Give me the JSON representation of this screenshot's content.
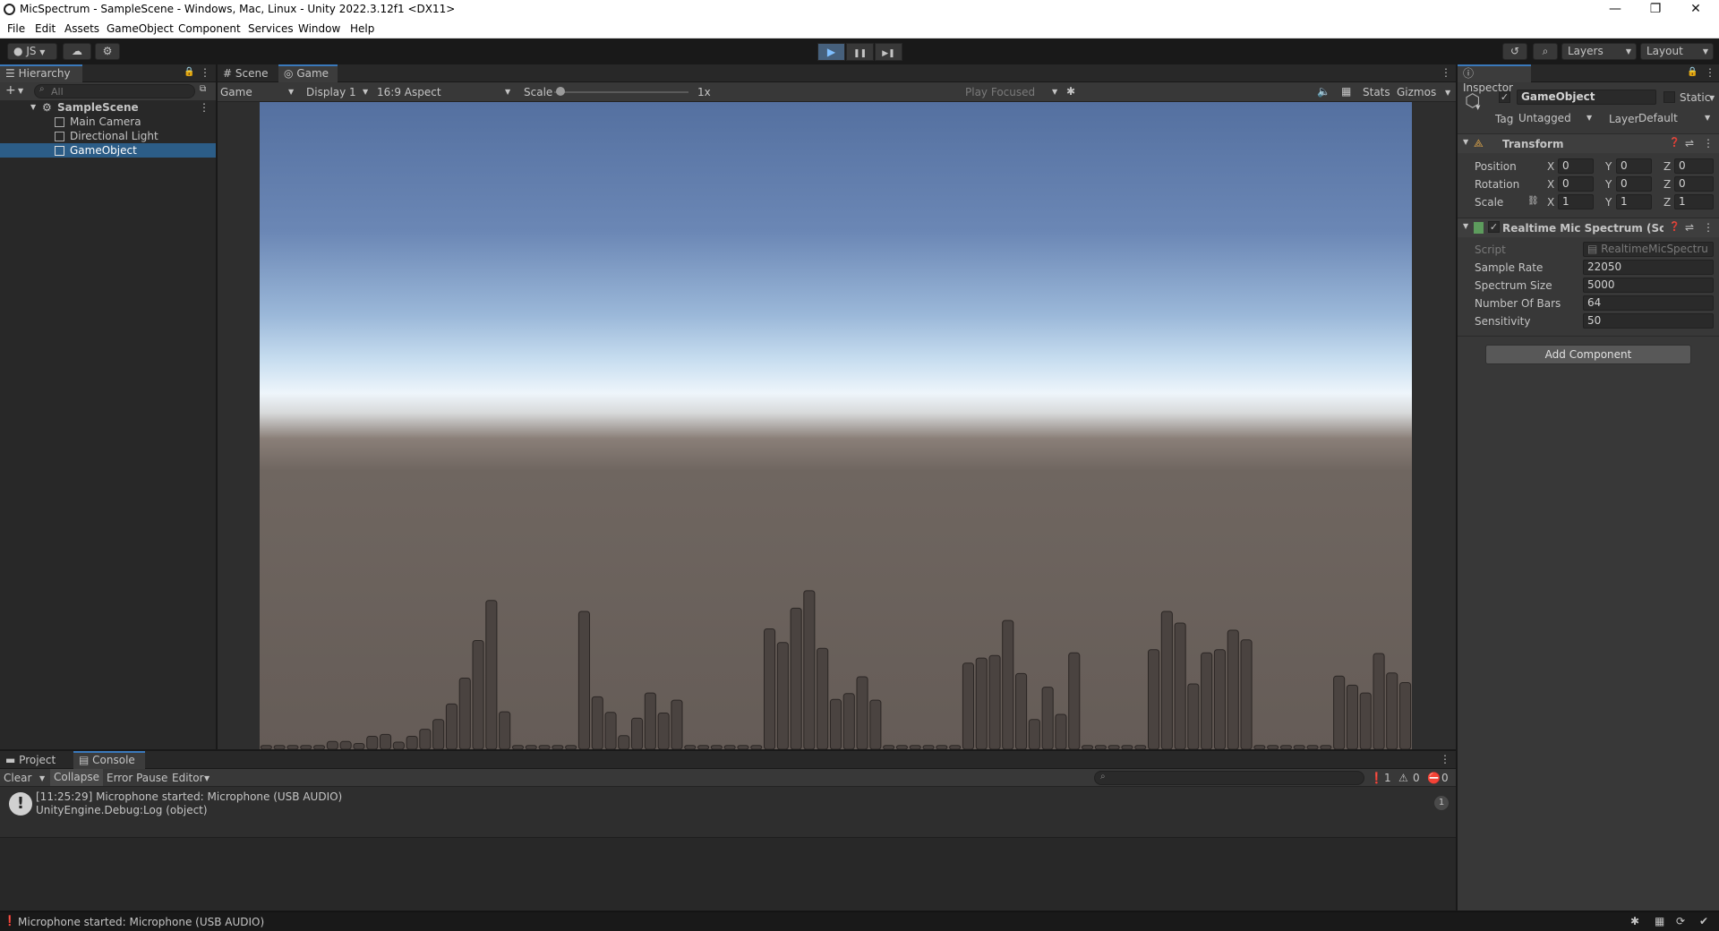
{
  "window": {
    "title": "MicSpectrum - SampleScene - Windows, Mac, Linux - Unity 2022.3.12f1 <DX11>",
    "minimize": "—",
    "maximize": "❐",
    "close": "✕"
  },
  "menu": [
    "File",
    "Edit",
    "Assets",
    "GameObject",
    "Component",
    "Services",
    "Window",
    "Help"
  ],
  "toolbar": {
    "account": "JS",
    "layers": "Layers",
    "layout": "Layout",
    "play": "▶",
    "pause": "❚❚",
    "step": "▶❚"
  },
  "hierarchy": {
    "tab": "Hierarchy",
    "search_placeholder": "All",
    "scene": "SampleScene",
    "items": [
      "Main Camera",
      "Directional Light",
      "GameObject"
    ]
  },
  "game": {
    "tabs": [
      "Scene",
      "Game"
    ],
    "mode": "Game",
    "display": "Display 1",
    "aspect": "16:9 Aspect",
    "scale_label": "Scale",
    "scale_value": "1x",
    "play_focused": "Play Focused",
    "stats": "Stats",
    "gizmos": "Gizmos",
    "bar_levels": [
      0.006,
      0.006,
      0.006,
      0.006,
      0.006,
      0.012,
      0.012,
      0.009,
      0.02,
      0.023,
      0.011,
      0.02,
      0.031,
      0.046,
      0.07,
      0.11,
      0.168,
      0.23,
      0.058,
      0.006,
      0.006,
      0.006,
      0.006,
      0.006,
      0.213,
      0.081,
      0.057,
      0.021,
      0.048,
      0.087,
      0.056,
      0.076,
      0.006,
      0.006,
      0.006,
      0.006,
      0.006,
      0.006,
      0.186,
      0.165,
      0.218,
      0.245,
      0.156,
      0.077,
      0.086,
      0.112,
      0.076,
      0.006,
      0.006,
      0.006,
      0.006,
      0.006,
      0.006,
      0.133,
      0.141,
      0.145,
      0.199,
      0.117,
      0.046,
      0.096,
      0.054,
      0.149,
      0.006,
      0.006,
      0.006,
      0.006,
      0.006,
      0.154,
      0.213,
      0.195,
      0.101,
      0.149,
      0.154,
      0.184,
      0.169,
      0.006,
      0.006,
      0.006,
      0.006,
      0.006,
      0.006,
      0.113,
      0.099,
      0.087,
      0.148,
      0.118,
      0.103
    ]
  },
  "inspector": {
    "tab": "Inspector",
    "object_name": "GameObject",
    "static_label": "Static",
    "tag_label": "Tag",
    "tag_value": "Untagged",
    "layer_label": "Layer",
    "layer_value": "Default",
    "transform": {
      "title": "Transform",
      "position_label": "Position",
      "rotation_label": "Rotation",
      "scale_label": "Scale",
      "position": {
        "x": "0",
        "y": "0",
        "z": "0"
      },
      "rotation": {
        "x": "0",
        "y": "0",
        "z": "0"
      },
      "scale": {
        "x": "1",
        "y": "1",
        "z": "1"
      },
      "axis_x": "X",
      "axis_y": "Y",
      "axis_z": "Z"
    },
    "script_component": {
      "title": "Realtime Mic Spectrum (Scri",
      "script_label": "Script",
      "script_value": "RealtimeMicSpectru",
      "fields": [
        {
          "label": "Sample Rate",
          "value": "22050"
        },
        {
          "label": "Spectrum Size",
          "value": "5000"
        },
        {
          "label": "Number Of Bars",
          "value": "64"
        },
        {
          "label": "Sensitivity",
          "value": "50"
        }
      ]
    },
    "add_component": "Add Component"
  },
  "console": {
    "tabs": [
      "Project",
      "Console"
    ],
    "clear": "Clear",
    "collapse": "Collapse",
    "error_pause": "Error Pause",
    "editor": "Editor",
    "count_info": "1",
    "count_warn": "0",
    "count_error": "0",
    "entry_line1": "[11:25:29] Microphone started: Microphone (USB AUDIO)",
    "entry_line2": "UnityEngine.Debug:Log (object)",
    "entry_count": "1"
  },
  "status": {
    "message": "Microphone started: Microphone (USB AUDIO)"
  }
}
